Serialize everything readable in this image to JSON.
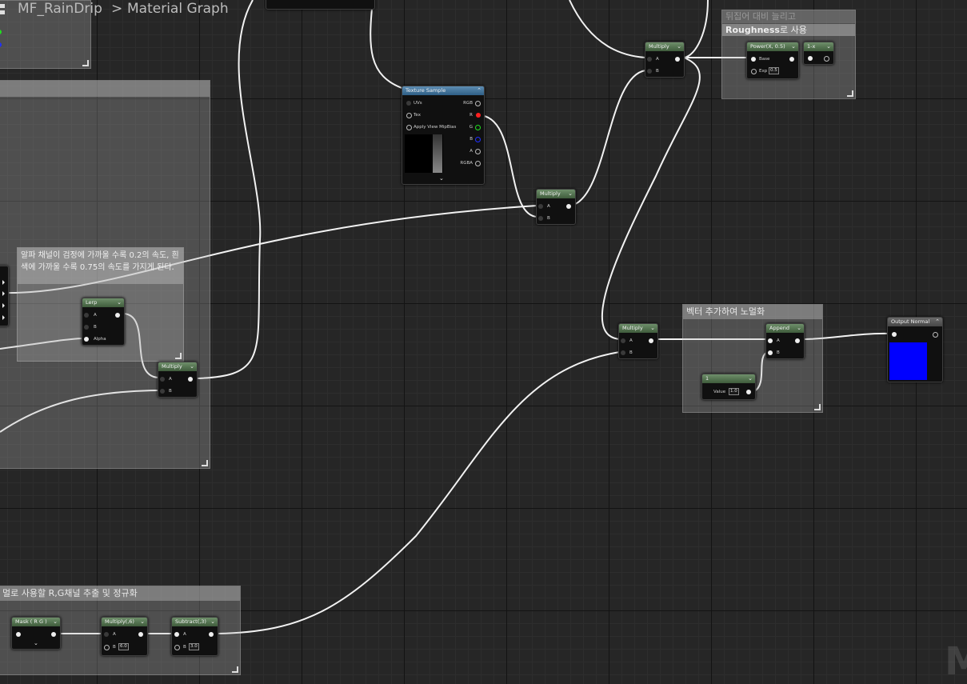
{
  "breadcrumb": {
    "asset": "MF_RainDrip",
    "separator": ">",
    "graph": "Material Graph"
  },
  "comments": {
    "roughness_line1": "뒤집어 대비 늘리고",
    "roughness_bold": "Roughness",
    "roughness_rest": "로 사용",
    "alpha_text": "알파 채널이 검정에 가까울 수록 0.2의 속도, 흰색에 가까울 수록 0.75의 속도를 가지게 된다.",
    "append_title": "벡터 추가하여 노멀화",
    "mask_title": "멀로 사용할 R,G채널 추출 및 정규화"
  },
  "nodes": {
    "texture_sample": {
      "title": "Texture Sample",
      "pins_in": [
        "UVs",
        "Tex",
        "Apply View MipBias"
      ],
      "pins_out": [
        "RGB",
        "R",
        "G",
        "B",
        "A",
        "RGBA"
      ]
    },
    "multiply_top": {
      "title": "Multiply",
      "a": "A",
      "b": "B"
    },
    "power": {
      "title": "Power(X, 0.5)",
      "base": "Base",
      "exp": "Exp",
      "exp_value": "0.5"
    },
    "one_minus": {
      "title": "1-x"
    },
    "multiply_mid": {
      "title": "Multiply",
      "a": "A",
      "b": "B"
    },
    "lerp": {
      "title": "Lerp",
      "a": "A",
      "b": "B",
      "alpha": "Alpha"
    },
    "multiply_left": {
      "title": "Multiply",
      "a": "A",
      "b": "B"
    },
    "multiply_right": {
      "title": "Multiply",
      "a": "A",
      "b": "B"
    },
    "append": {
      "title": "Append",
      "a": "A",
      "b": "B"
    },
    "constant": {
      "title": "1",
      "label": "Value",
      "value": "1.0"
    },
    "output_normal": {
      "title": "Output Normal",
      "color": "#0000ff"
    },
    "mask": {
      "title": "Mask ( R G )"
    },
    "multiply_bottom": {
      "title": "Multiply(,6)",
      "a": "A",
      "b": "B",
      "b_value": "6.0"
    },
    "subtract": {
      "title": "Subtract(,3)",
      "a": "A",
      "b": "B",
      "b_value": "3.0"
    }
  },
  "watermark": "M",
  "colors": {
    "pin_r": "#ff2020",
    "pin_g": "#20e020",
    "pin_b": "#2030ff",
    "blue_preview": "#0000ff"
  }
}
